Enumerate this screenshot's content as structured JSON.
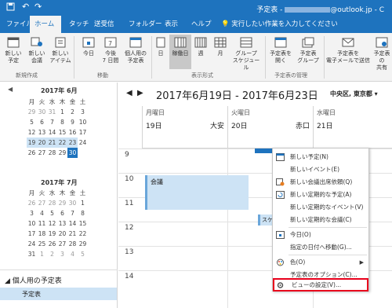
{
  "window": {
    "title": "予定表 - ",
    "email": "@outlook.jp",
    "title_tail": " - C"
  },
  "tabs": [
    "ファイル",
    "ホーム",
    "タッチ",
    "送受信",
    "フォルダー",
    "表示",
    "ヘルプ"
  ],
  "active_tab": "ホーム",
  "tell_me": "実行したい作業を入力してください",
  "ribbon": {
    "new_appointment": "新しい\n予定",
    "new_meeting": "新しい\n会議",
    "new_items": "新しい\nアイテム",
    "today": "今日",
    "next7": "今後\n7 日間",
    "personal_cal": "個人用の\n予定表",
    "day": "日",
    "workweek": "稼働日",
    "week": "週",
    "month": "月",
    "group_schedule": "グループ\nスケジュール",
    "open_cal": "予定表を\n開く",
    "cal_groups": "予定表\nグループ",
    "email_cal": "予定表を\n電子メールで送信",
    "share": "予定表の\n共有",
    "groups": {
      "new": "新規作成",
      "move": "移動",
      "view": "表示形式",
      "manage": "予定表の管理"
    }
  },
  "minical": [
    {
      "title": "2017年 6月",
      "weekdays": [
        "月",
        "火",
        "水",
        "木",
        "金",
        "土"
      ],
      "rows": [
        [
          "29",
          "30",
          "31",
          "1",
          "2",
          "3"
        ],
        [
          "5",
          "6",
          "7",
          "8",
          "9",
          "10"
        ],
        [
          "12",
          "13",
          "14",
          "15",
          "16",
          "17"
        ],
        [
          "19",
          "20",
          "21",
          "22",
          "23",
          "24"
        ],
        [
          "26",
          "27",
          "28",
          "29",
          "30",
          ""
        ]
      ]
    },
    {
      "title": "2017年 7月",
      "weekdays": [
        "月",
        "火",
        "水",
        "木",
        "金",
        "土"
      ],
      "rows": [
        [
          "26",
          "27",
          "28",
          "29",
          "30",
          "1"
        ],
        [
          "3",
          "4",
          "5",
          "6",
          "7",
          "8"
        ],
        [
          "10",
          "11",
          "12",
          "13",
          "14",
          "15"
        ],
        [
          "17",
          "18",
          "19",
          "20",
          "21",
          "22"
        ],
        [
          "24",
          "25",
          "26",
          "27",
          "28",
          "29"
        ],
        [
          "31",
          "1",
          "2",
          "3",
          "4",
          "5"
        ]
      ]
    }
  ],
  "sidebar": {
    "section": "個人用の予定表",
    "item": "予定表"
  },
  "calendar": {
    "range": "2017年6月19日 - 2017年6月23日",
    "location": "中央区, 東京都",
    "days": [
      {
        "name": "月曜日",
        "date": "19日",
        "note": "大安"
      },
      {
        "name": "火曜日",
        "date": "20日",
        "note": "赤口"
      },
      {
        "name": "水曜日",
        "date": "21日",
        "note": ""
      }
    ],
    "hours": [
      "9",
      "10",
      "11",
      "12",
      "13",
      "14"
    ],
    "events": [
      {
        "label": "会議"
      },
      {
        "label": "スケジ"
      }
    ]
  },
  "context_menu": [
    {
      "label": "新しい予定(N)",
      "icon": "calendar-icon"
    },
    {
      "label": "新しいイベント(E)",
      "icon": ""
    },
    {
      "label": "新しい会議出席依頼(Q)",
      "icon": "meeting-icon"
    },
    {
      "label": "新しい定期的な予定(A)",
      "icon": "recurring-icon"
    },
    {
      "label": "新しい定期的なイベント(V)",
      "icon": ""
    },
    {
      "label": "新しい定期的な会議(C)",
      "icon": ""
    },
    {
      "label": "今日(O)",
      "icon": "today-icon"
    },
    {
      "label": "指定の日付へ移動(G)...",
      "icon": ""
    },
    {
      "label": "色(O)",
      "icon": "color-icon"
    },
    {
      "label": "予定表のオプション(C)...",
      "icon": ""
    },
    {
      "label": "ビューの設定(V)...",
      "icon": "settings-icon"
    }
  ]
}
